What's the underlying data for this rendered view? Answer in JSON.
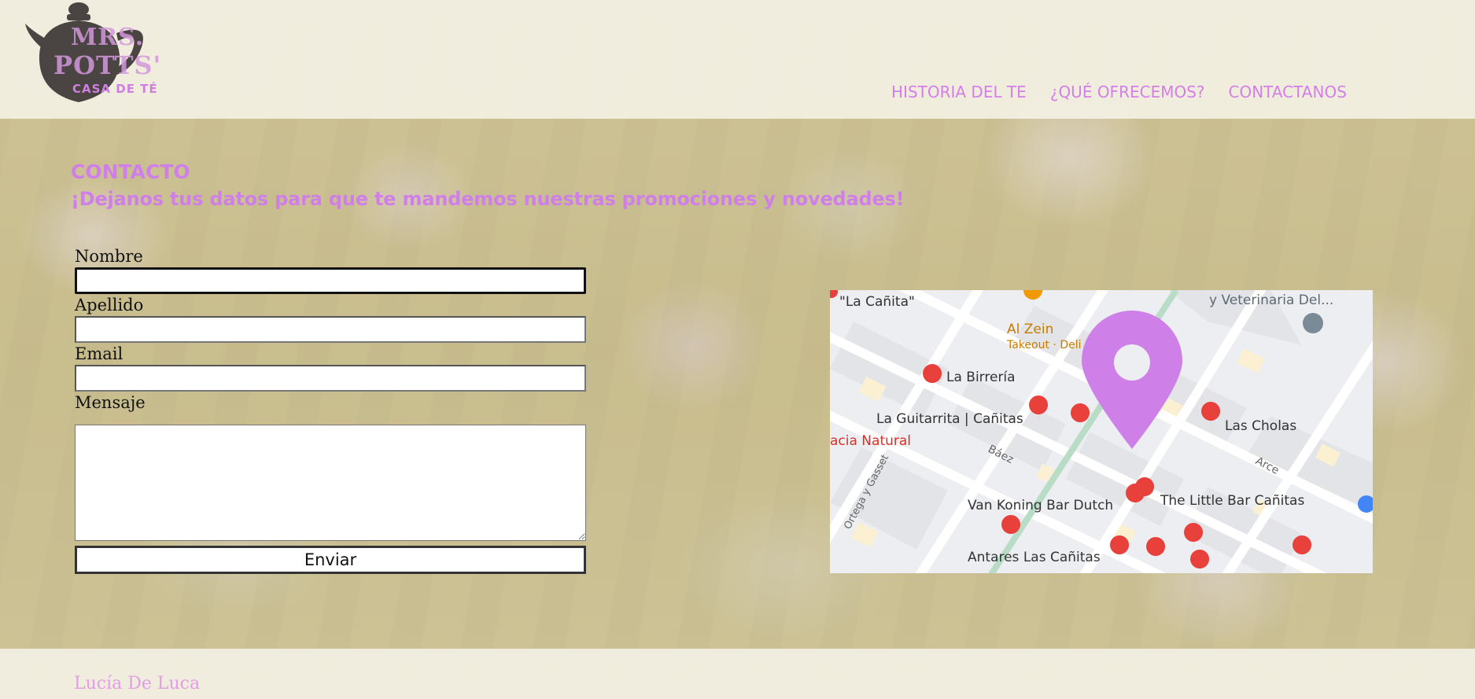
{
  "brand": {
    "logo_line1": "MRS.",
    "logo_line2": "POTTS'",
    "logo_line3": "CASA DE TÉ",
    "icon": "teapot-icon",
    "accent_color": "#d07fe8"
  },
  "nav": {
    "items": [
      {
        "label": "HISTORIA DEL TE"
      },
      {
        "label": "¿QUÉ OFRECEMOS?"
      },
      {
        "label": "CONTACTANOS"
      }
    ]
  },
  "contact": {
    "title": "CONTACTO",
    "subtitle": "¡Dejanos tus datos para que te mandemos nuestras promociones y novedades!"
  },
  "form": {
    "fields": [
      {
        "label": "Nombre",
        "value": ""
      },
      {
        "label": "Apellido",
        "value": ""
      },
      {
        "label": "Email",
        "value": ""
      },
      {
        "label": "Mensaje",
        "value": ""
      }
    ],
    "submit_label": "Enviar"
  },
  "map": {
    "places": [
      {
        "name": "\"La Cañita\""
      },
      {
        "name": "Al Zein"
      },
      {
        "name": "Takeout · Deli"
      },
      {
        "name": "y Veterinaria Del..."
      },
      {
        "name": "La Birrería"
      },
      {
        "name": "La Guitarrita | Cañitas"
      },
      {
        "name": "Las Cholas"
      },
      {
        "name": "acia Natural"
      },
      {
        "name": "Van Koning Bar Dutch"
      },
      {
        "name": "The Little Bar Cañitas"
      },
      {
        "name": "Antares Las Cañitas"
      }
    ],
    "streets": [
      {
        "name": "Báez"
      },
      {
        "name": "Arce"
      },
      {
        "name": "Ortega y Gasset"
      }
    ],
    "pin_color": "#cf7fe8",
    "marker_color": "#e8403a"
  },
  "footer": {
    "author": "Lucía De Luca"
  }
}
